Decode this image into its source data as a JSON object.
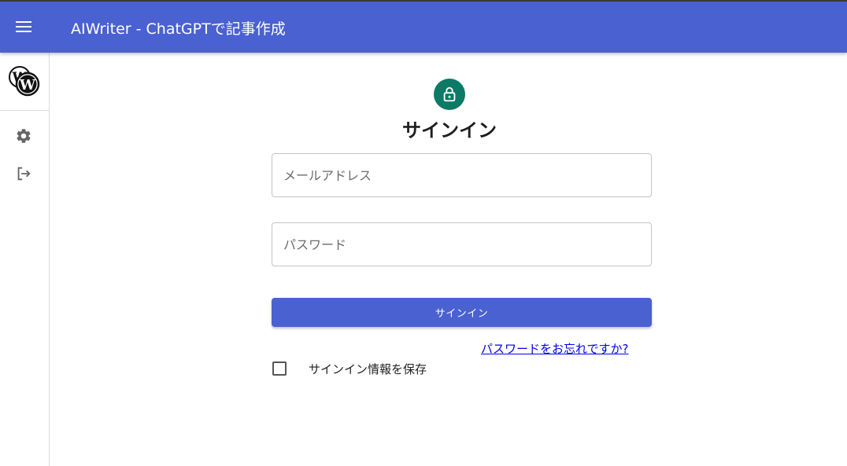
{
  "appbar": {
    "title": "AIWriter - ChatGPTで記事作成",
    "color": "#4a61d1"
  },
  "sidebar": {
    "items": [
      {
        "icon": "wordpress-icon"
      },
      {
        "icon": "gear-icon"
      },
      {
        "icon": "logout-icon"
      }
    ]
  },
  "signin": {
    "icon": "lock-icon",
    "avatar_color": "#0d7a66",
    "heading": "サインイン",
    "email_placeholder": "メールアドレス",
    "password_placeholder": "パスワード",
    "submit_label": "サインイン",
    "forgot_link": "パスワードをお忘れですか?",
    "remember_label": "サインイン情報を保存"
  }
}
